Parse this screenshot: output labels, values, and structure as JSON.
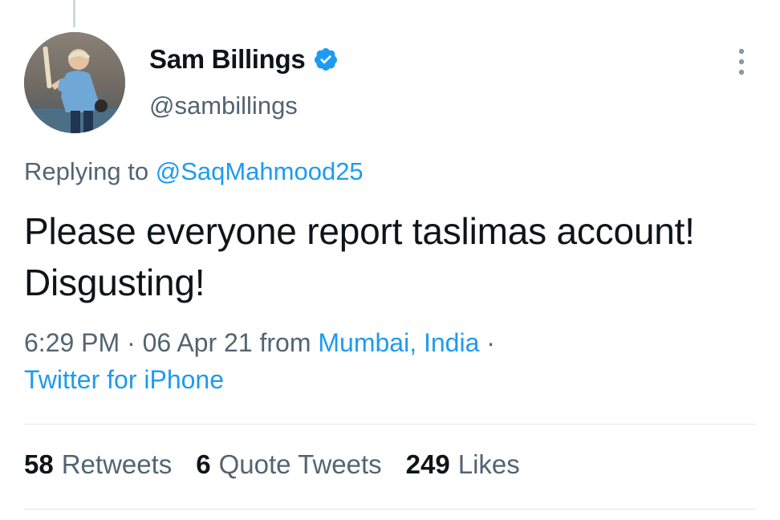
{
  "author": {
    "display_name": "Sam Billings",
    "handle": "@sambillings",
    "verified": true,
    "avatar_icon": "cricketer-avatar-photo"
  },
  "reply": {
    "prefix": "Replying to",
    "to_handle": "@SaqMahmood25"
  },
  "tweet": {
    "text": "Please everyone report taslimas account! Disgusting!",
    "time": "6:29 PM",
    "date": "06 Apr 21",
    "from_word": "from",
    "location": "Mumbai, India",
    "source": "Twitter for iPhone"
  },
  "stats": {
    "retweets_count": "58",
    "retweets_label": "Retweets",
    "quotes_count": "6",
    "quotes_label": "Quote Tweets",
    "likes_count": "249",
    "likes_label": "Likes"
  },
  "colors": {
    "link": "#1d9bf0",
    "secondary_text": "#536471",
    "primary_text": "#0f1419"
  }
}
